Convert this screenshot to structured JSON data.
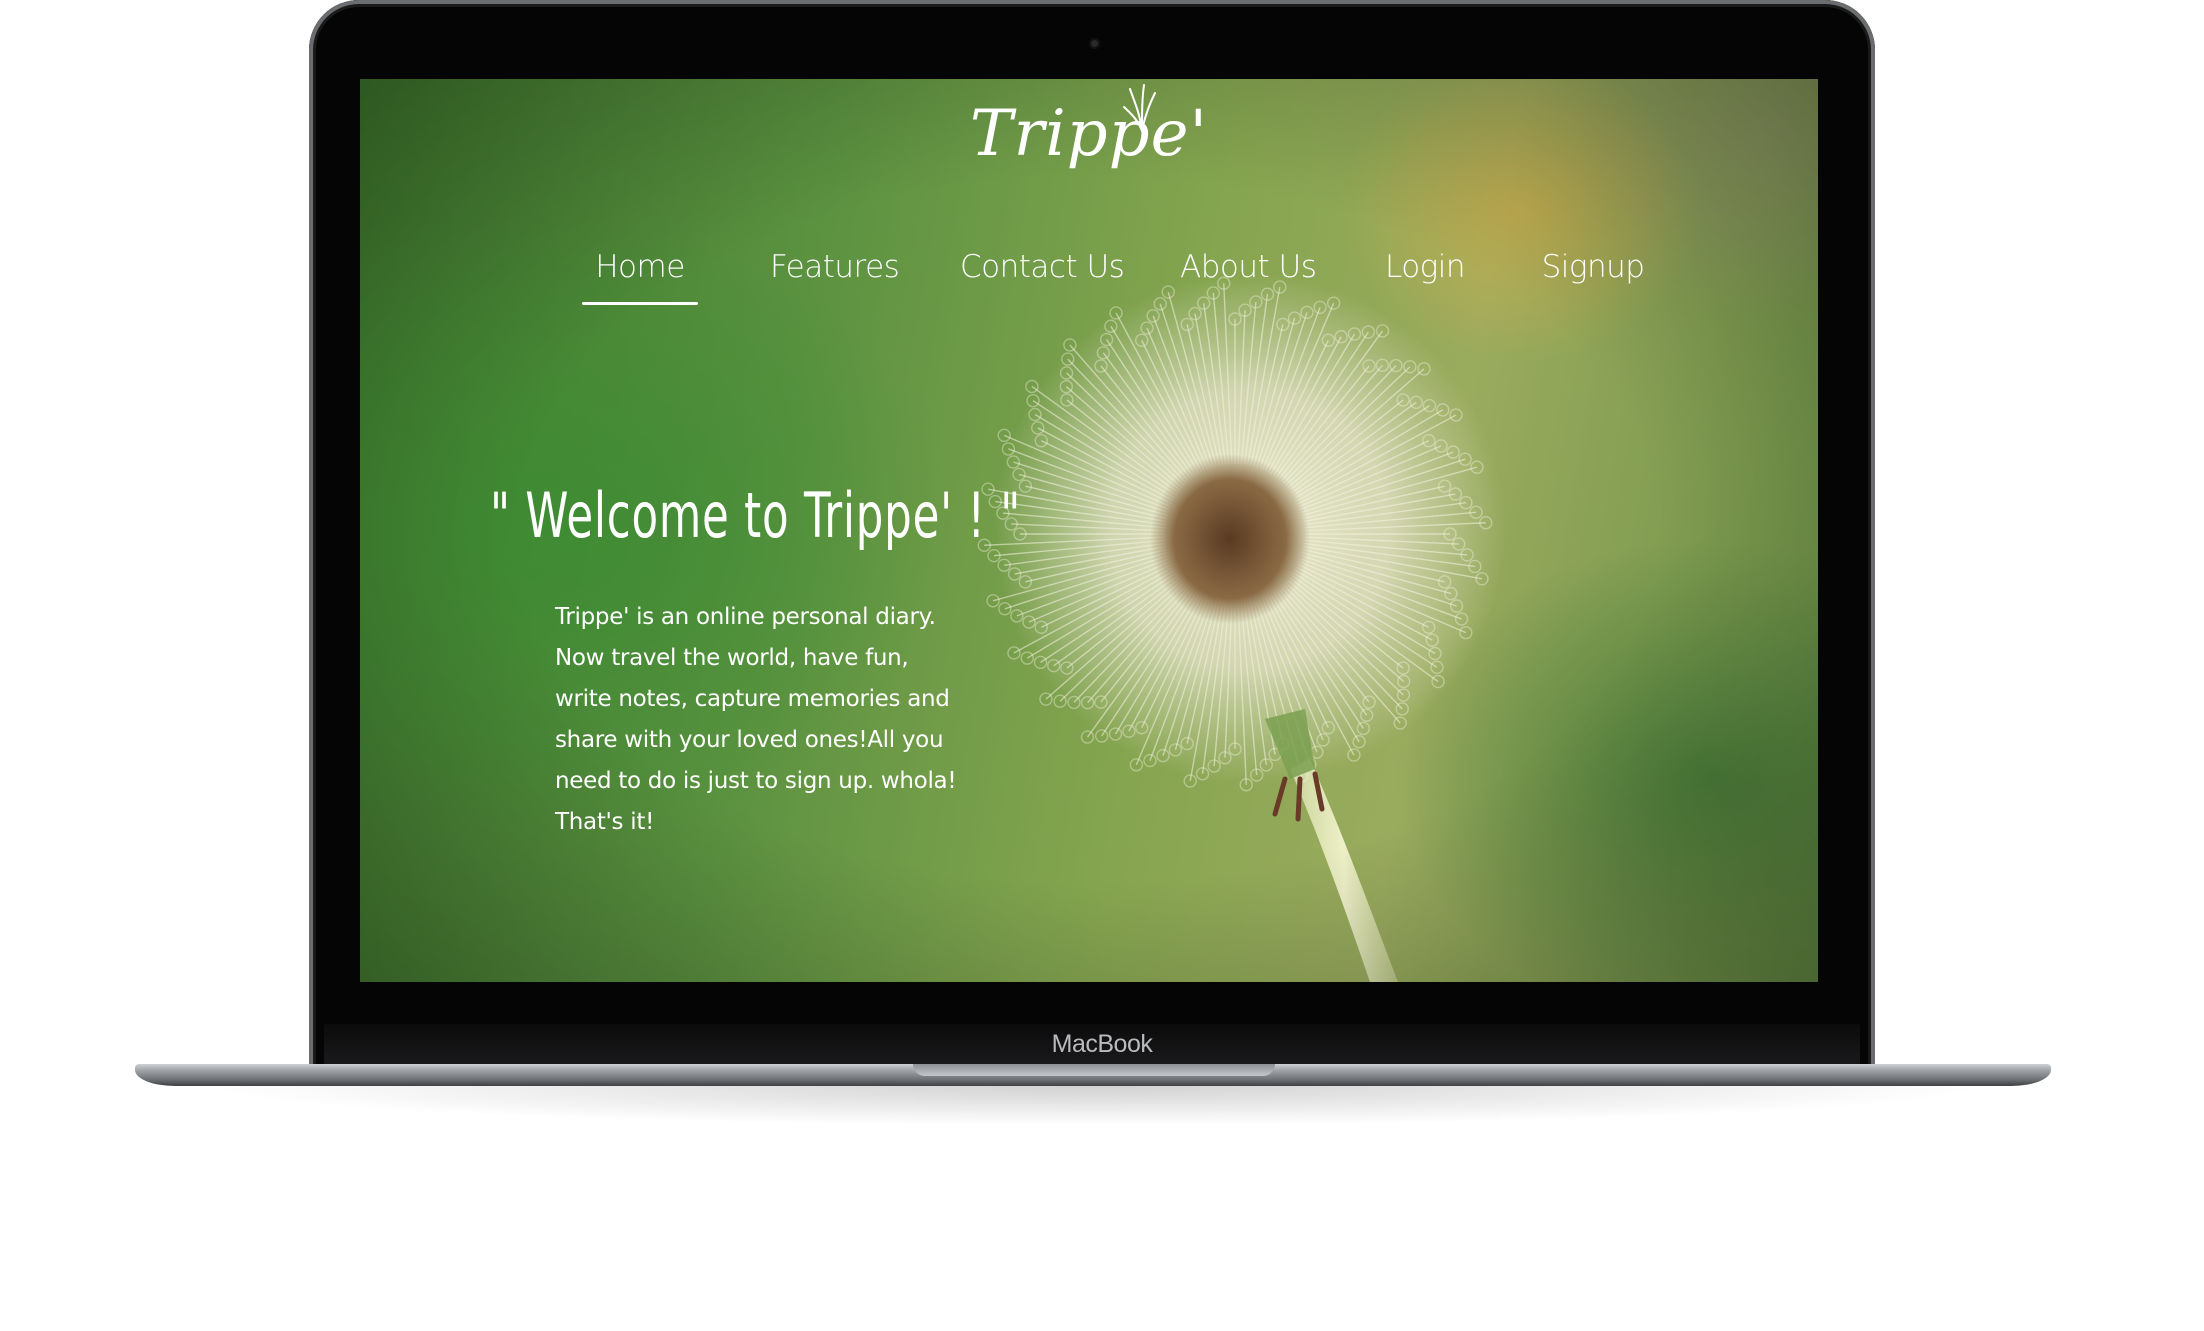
{
  "device": {
    "brand_label": "MacBook"
  },
  "site": {
    "logo_text": "Trippe'",
    "nav": {
      "items": [
        {
          "label": "Home",
          "active": true
        },
        {
          "label": "Features",
          "active": false
        },
        {
          "label": "Contact Us",
          "active": false
        },
        {
          "label": "About Us",
          "active": false
        },
        {
          "label": "Login",
          "active": false
        },
        {
          "label": "Signup",
          "active": false
        }
      ]
    },
    "hero": {
      "heading": "\" Welcome to Trippe' ! \"",
      "intro": "Trippe' is an online personal diary. Now travel the world, have fun, write notes, capture memories and share with your loved ones!All you need to do is just to sign up. whola! That's it!"
    }
  },
  "colors": {
    "text": "#ffffff",
    "bezel": "#050505",
    "background_green": "#5b9240"
  }
}
